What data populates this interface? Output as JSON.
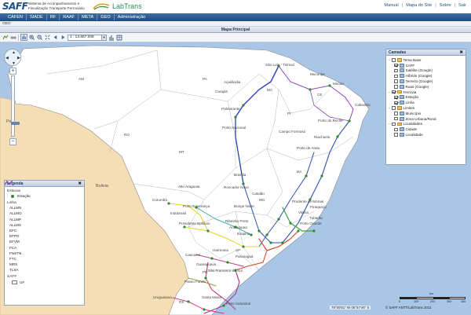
{
  "header": {
    "logo": "SAFF",
    "logo_subtitle": "Sistema de Acompanhamento e Fiscalização Transporte Ferroviário",
    "partner_logo_1": "ANTT",
    "partner_logo_2": "LabTrans",
    "links": [
      "Manual",
      "Mapa do Site",
      "Sobre",
      "Sair"
    ]
  },
  "menu": [
    "CAFEN",
    "SIADE",
    "RF",
    "RAAF",
    "META",
    "GEO",
    "Administração"
  ],
  "breadcrumb": "GEO",
  "map_title": "Mapa Principal",
  "toolbar": {
    "icons": [
      "save-icon",
      "measure-icon",
      "pan-icon",
      "zoom-in-icon",
      "zoom-out-icon",
      "full-extent-icon",
      "back-icon",
      "forward-icon"
    ],
    "scale_value": "1 : 13.867.008",
    "extra_icons": [
      "chart-icon",
      "table-icon"
    ]
  },
  "map": {
    "countries": [
      "Peru",
      "Bolivia"
    ],
    "state_labels": [
      "AM",
      "PA",
      "RO",
      "MT",
      "MA",
      "CE",
      "PI",
      "BA",
      "MG",
      "SP",
      "PR",
      "RS"
    ],
    "cities": [
      "São Luís - Tirirical",
      "Mucuripe",
      "Macau",
      "Cabedelo",
      "Açailândia",
      "Carajás",
      "Palmerante",
      "Porto do Recife",
      "Porto Nacional",
      "Campo Formoso",
      "Riachuelo",
      "Porto de Aratu",
      "Brasília",
      "Roncador Novo",
      "Alto Araguaia",
      "Catalão",
      "Corumbá",
      "Porto Esperança",
      "Indubrasil",
      "Bunge Norte",
      "Presidente Epitácio",
      "Prudente de Morais",
      "Vitória",
      "Piraquaçu",
      "Tubarão",
      "Porto Grande",
      "Ribeirão Preto",
      "Araraquara",
      "Itirapina",
      "Cascavel",
      "Harmonia",
      "Paranaguá",
      "Guarapuava",
      "São Francisco do Sul",
      "Passo Fundo",
      "Uruguaiana",
      "Santa Maria",
      "Porto Industrial"
    ]
  },
  "legend": {
    "title": "Legenda",
    "station_section": "Estacao",
    "station_label": "Estação",
    "line_section": "Linha",
    "lines": [
      {
        "name": "ALLMN",
        "color": "#d33b7f"
      },
      {
        "name": "ALLMO",
        "color": "#e8d12a"
      },
      {
        "name": "ALLMP",
        "color": "#c4427e"
      },
      {
        "name": "ALLMS",
        "color": "#b02a8a"
      },
      {
        "name": "EFC",
        "color": "#2a3fbf"
      },
      {
        "name": "EFPO",
        "color": "#8aa43c"
      },
      {
        "name": "EFVM",
        "color": "#3aa23a"
      },
      {
        "name": "FCA",
        "color": "#2b4fb6"
      },
      {
        "name": "FNSTN",
        "color": "#123e9a"
      },
      {
        "name": "FTC",
        "color": "#4bb0b7"
      },
      {
        "name": "MRS",
        "color": "#d64a2c"
      },
      {
        "name": "TLSA",
        "color": "#8b44c3"
      }
    ],
    "saff_section": "SAFF",
    "uf_label": "UF"
  },
  "layers": {
    "title": "Camadas",
    "groups": [
      {
        "name": "Tema Base",
        "items": [
          "SAFF",
          "Satélite (Google)",
          "Híbrido (Google)",
          "Terreno (Google)",
          "Ruas (Google)"
        ]
      },
      {
        "name": "Ferrovia",
        "items": [
          "Estação",
          "Linha"
        ]
      },
      {
        "name": "Limites",
        "items": [
          "Município",
          "Zona Urbana/Rural"
        ]
      },
      {
        "name": "Localidades",
        "items": [
          "Cidade",
          "Localidade"
        ]
      }
    ]
  },
  "scale": {
    "unit": "km",
    "ticks": [
      "0",
      "100",
      "200",
      "300",
      "400"
    ]
  },
  "coordinates": "78°05'51\" W 05°57'46\" S",
  "copyright": "© SAFF ANTT/LabTrans 2011",
  "colors": {
    "menu_bar": "#2a5a92",
    "ocean": "#a9c6e6",
    "foreign": "#f5deb3",
    "brazil": "#ffffff"
  }
}
